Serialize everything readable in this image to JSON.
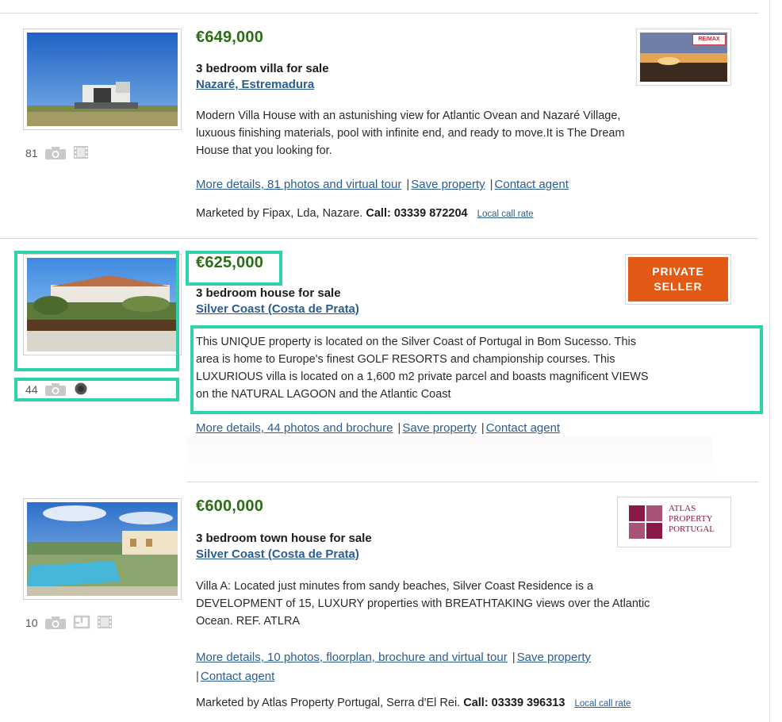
{
  "colors": {
    "price": "#2b6e16",
    "link": "#2a5d92",
    "private_badge": "#e35a16",
    "highlight": "#2ed3ad"
  },
  "listings": [
    {
      "price": "€649,000",
      "type": "3 bedroom villa for sale",
      "location": "Nazaré, Estremadura",
      "desc_lines": [
        "Modern Villa House with an astunishing view for Atlantic Ovean and Nazaré Village,",
        "luxuous finishing materials, pool with infinite end, and ready to move.It is The Dream",
        "House that you looking for."
      ],
      "photo_count": "81",
      "media_icons": [
        "camera-icon",
        "film-icon"
      ],
      "links": [
        "More details, 81 photos and virtual tour",
        "Save property",
        "Contact agent"
      ],
      "marketed_by": "Marketed by Fipax, Lda, Nazare.",
      "call_label": "Call: 03339 872204",
      "local_rate": "Local call rate",
      "logo_brand": "RE/MAX"
    },
    {
      "price": "€625,000",
      "type": "3 bedroom house for sale",
      "location": "Silver Coast (Costa de Prata)",
      "desc_lines": [
        "This UNIQUE property is located on the Silver Coast of Portugal in Bom Sucesso. This",
        "area is home to Europe's finest GOLF RESORTS and championship courses. This",
        "LUXURIOUS villa is located on a 1,600 m2 private parcel and boasts magnificent VIEWS",
        "on the NATURAL LAGOON and the Atlantic Coast"
      ],
      "photo_count": "44",
      "media_icons": [
        "camera-icon",
        "brochure-icon"
      ],
      "links": [
        "More details, 44 photos and brochure",
        "Save property",
        "Contact agent"
      ],
      "badge_lines": [
        "PRIVATE",
        "SELLER"
      ]
    },
    {
      "price": "€600,000",
      "type": "3 bedroom town house for sale",
      "location": "Silver Coast (Costa de Prata)",
      "desc_lines": [
        "Villa A: Located just minutes from sandy beaches, Silver Coast Residence is a",
        "DEVELOPMENT of 15, LUXURY properties with BREATHTAKING views over the Atlantic",
        "Ocean. REF. ATLRA"
      ],
      "photo_count": "10",
      "media_icons": [
        "camera-icon",
        "floorplan-icon",
        "film-icon"
      ],
      "links": [
        "More details, 10 photos, floorplan, brochure and virtual tour",
        "Save property",
        "Contact agent"
      ],
      "marketed_by": "Marketed by Atlas Property Portugal, Serra d'El Rei.",
      "call_label": "Call: 03339 396313",
      "local_rate": "Local call rate",
      "logo_lines": [
        "ATLAS",
        "PROPERTY",
        "PORTUGAL"
      ]
    }
  ]
}
